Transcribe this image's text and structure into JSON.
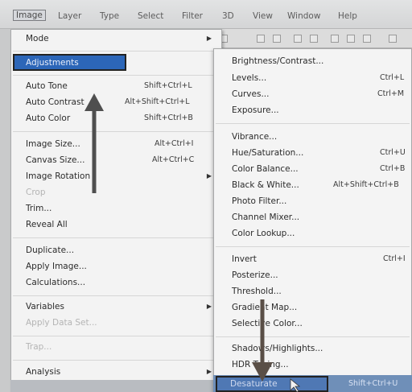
{
  "menubar": {
    "items": [
      "Image",
      "Layer",
      "Type",
      "Select",
      "Filter",
      "3D",
      "View",
      "Window",
      "Help"
    ]
  },
  "image_menu": [
    {
      "label": "Mode",
      "submenu": true
    },
    {
      "label": "Adjustments",
      "submenu": true,
      "highlighted": true
    },
    {
      "label": "Auto Tone",
      "shortcut": "Shift+Ctrl+L"
    },
    {
      "label": "Auto Contrast",
      "shortcut": "Alt+Shift+Ctrl+L"
    },
    {
      "label": "Auto Color",
      "shortcut": "Shift+Ctrl+B"
    },
    {
      "label": "Image Size...",
      "shortcut": "Alt+Ctrl+I"
    },
    {
      "label": "Canvas Size...",
      "shortcut": "Alt+Ctrl+C"
    },
    {
      "label": "Image Rotation",
      "submenu": true
    },
    {
      "label": "Crop",
      "disabled": true
    },
    {
      "label": "Trim..."
    },
    {
      "label": "Reveal All"
    },
    {
      "label": "Duplicate..."
    },
    {
      "label": "Apply Image..."
    },
    {
      "label": "Calculations..."
    },
    {
      "label": "Variables",
      "submenu": true
    },
    {
      "label": "Apply Data Set...",
      "disabled": true
    },
    {
      "label": "Trap...",
      "disabled": true
    },
    {
      "label": "Analysis",
      "submenu": true
    }
  ],
  "adjustments_menu": [
    {
      "label": "Brightness/Contrast..."
    },
    {
      "label": "Levels...",
      "shortcut": "Ctrl+L"
    },
    {
      "label": "Curves...",
      "shortcut": "Ctrl+M"
    },
    {
      "label": "Exposure..."
    },
    {
      "label": "Vibrance..."
    },
    {
      "label": "Hue/Saturation...",
      "shortcut": "Ctrl+U"
    },
    {
      "label": "Color Balance...",
      "shortcut": "Ctrl+B"
    },
    {
      "label": "Black & White...",
      "shortcut": "Alt+Shift+Ctrl+B"
    },
    {
      "label": "Photo Filter..."
    },
    {
      "label": "Channel Mixer..."
    },
    {
      "label": "Color Lookup..."
    },
    {
      "label": "Invert",
      "shortcut": "Ctrl+I"
    },
    {
      "label": "Posterize..."
    },
    {
      "label": "Threshold..."
    },
    {
      "label": "Gradient Map..."
    },
    {
      "label": "Selective Color..."
    },
    {
      "label": "Shadows/Highlights..."
    },
    {
      "label": "HDR Toning..."
    },
    {
      "label": "Desaturate",
      "shortcut": "Shift+Ctrl+U",
      "highlighted": true
    }
  ],
  "colors": {
    "highlight": "#2c66b8",
    "arrow": "#4f4f4f"
  }
}
